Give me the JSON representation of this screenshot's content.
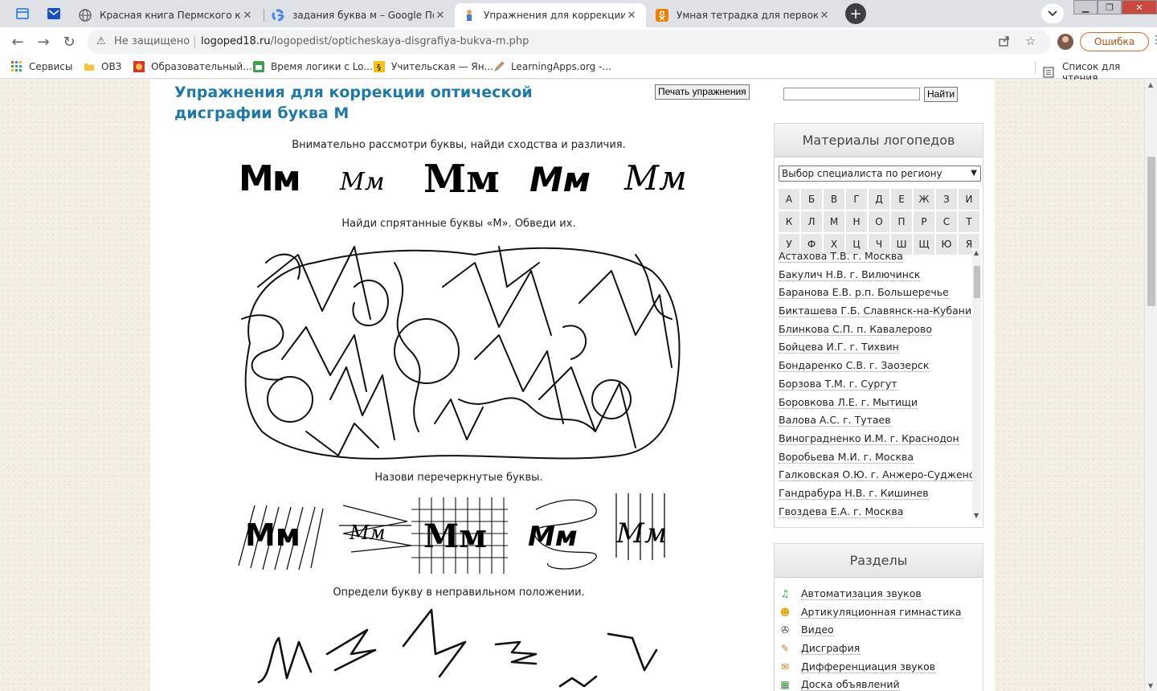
{
  "browser": {
    "tabs": [
      {
        "title": "Красная книга Пермского края",
        "icon": "globe-icon"
      },
      {
        "title": "задания буква м – Google Поиск",
        "icon": "google-icon"
      },
      {
        "title": "Упражнения для коррекции оп",
        "icon": "logoped-icon",
        "active": true
      },
      {
        "title": "Умная тетрадка для первоклас",
        "icon": "odnoklassniki-icon"
      }
    ],
    "new_tab": "+",
    "address": {
      "security": "Не защищено",
      "domain": "logoped18.ru",
      "path": "/logopedist/opticheskaya-disgrafiya-bukva-m.php"
    },
    "profile_status": "Ошибка"
  },
  "bookmarks": {
    "items": [
      "Сервисы",
      "ОВЗ",
      "Образовательный...",
      "Время логики с Lo...",
      "Учительская — Ян...",
      "LearningApps.org -..."
    ],
    "reading_list": "Список для чтения"
  },
  "page": {
    "title": "Упражнения для коррекции оптической дисграфии буква М",
    "print_button": "Печать упражнения",
    "search_button": "Найти",
    "search_value": "",
    "instructions": [
      "Внимательно рассмотри буквы, найди сходства и различия.",
      "Найди спрятанные буквы «М». Обведи их.",
      "Назови перечеркнутые буквы.",
      "Определи букву в неправильном положении."
    ],
    "letter_samples": [
      "Мм",
      "Мм",
      "Мм",
      "Мм",
      "Мм"
    ]
  },
  "sidebar": {
    "materials_title": "Материалы логопедов",
    "region_select": "Выбор специалиста по региону",
    "alphabet": [
      "А",
      "Б",
      "В",
      "Г",
      "Д",
      "Е",
      "Ж",
      "З",
      "И",
      "К",
      "Л",
      "М",
      "Н",
      "О",
      "П",
      "Р",
      "С",
      "Т",
      "У",
      "Ф",
      "Х",
      "Ц",
      "Ч",
      "Ш",
      "Щ",
      "Ю",
      "Я"
    ],
    "specialists": [
      "Астахова Т.В. г. Москва",
      "Бакулич Н.В. г. Вилючинск",
      "Баранова Е.В. р.п. Большеречье",
      "Бикташева Г.Б. Славянск-на-Кубани",
      "Блинкова С.П. п. Кавалерово",
      "Бойцева И.Г. г. Тихвин",
      "Бондаренко С.В. г. Заозерск",
      "Борзова Т.М. г. Сургут",
      "Боровкова Л.Е. г. Мытищи",
      "Валова А.С. г. Тутаев",
      "Виноградненко И.М. г. Краснодон",
      "Воробьева М.И. г. Москва",
      "Галковская О.Ю. г. Анжеро-Судженск",
      "Гандрабура Н.В. г. Кишинев",
      "Гвоздева Е.А. г. Москва"
    ],
    "sections_title": "Разделы",
    "sections": [
      {
        "label": "Автоматизация звуков",
        "icon": "music-note-icon",
        "color": "#2e9a2e"
      },
      {
        "label": "Артикуляционная гимнастика",
        "icon": "smiley-icon",
        "color": "#e0a800"
      },
      {
        "label": "Видео",
        "icon": "film-reel-icon",
        "color": "#444444"
      },
      {
        "label": "Дисграфия",
        "icon": "notepad-icon",
        "color": "#c07a20"
      },
      {
        "label": "Дифференциация звуков",
        "icon": "speech-icon",
        "color": "#e07a10"
      },
      {
        "label": "Доска объявлений",
        "icon": "board-icon",
        "color": "#3a8a3a"
      }
    ]
  }
}
